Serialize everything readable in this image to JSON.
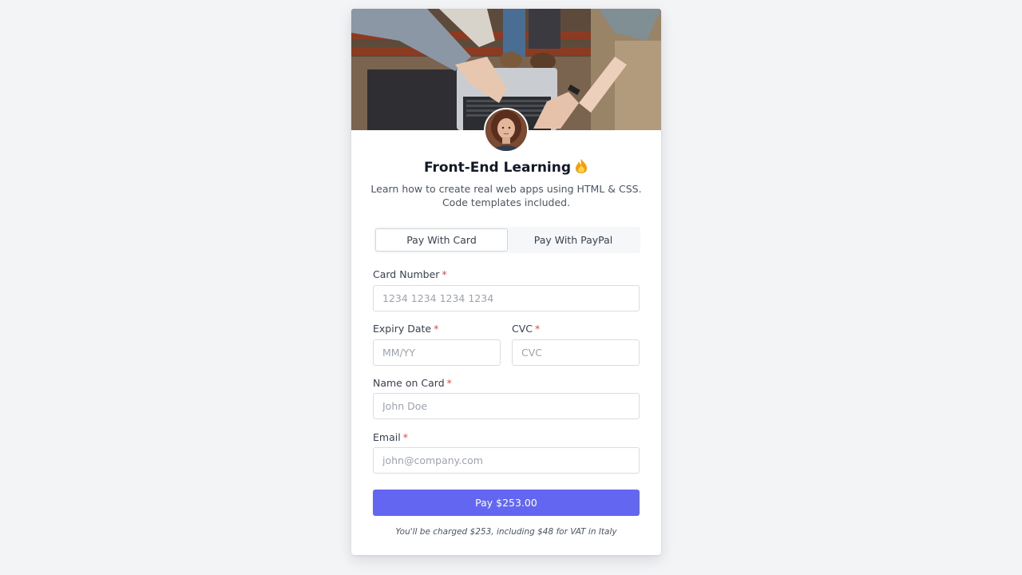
{
  "course": {
    "title": "Front-End Learning",
    "title_emoji": "fire-icon",
    "subtitle_line1": "Learn how to create real web apps using HTML & CSS.",
    "subtitle_line2": "Code templates included."
  },
  "tabs": [
    {
      "label": "Pay With Card",
      "active": true
    },
    {
      "label": "Pay With PayPal",
      "active": false
    }
  ],
  "form": {
    "required_marker": "*",
    "card_number": {
      "label": "Card Number",
      "placeholder": "1234 1234 1234 1234",
      "value": ""
    },
    "expiry": {
      "label": "Expiry Date",
      "placeholder": "MM/YY",
      "value": ""
    },
    "cvc": {
      "label": "CVC",
      "placeholder": "CVC",
      "value": ""
    },
    "name": {
      "label": "Name on Card",
      "placeholder": "John Doe",
      "value": ""
    },
    "email": {
      "label": "Email",
      "placeholder": "john@company.com",
      "value": ""
    }
  },
  "pay_button": "Pay $253.00",
  "charge_note": "You'll be charged $253, including $48 for VAT in Italy",
  "colors": {
    "accent": "#6366f1",
    "required": "#ef4444",
    "background": "#f3f4f6"
  }
}
